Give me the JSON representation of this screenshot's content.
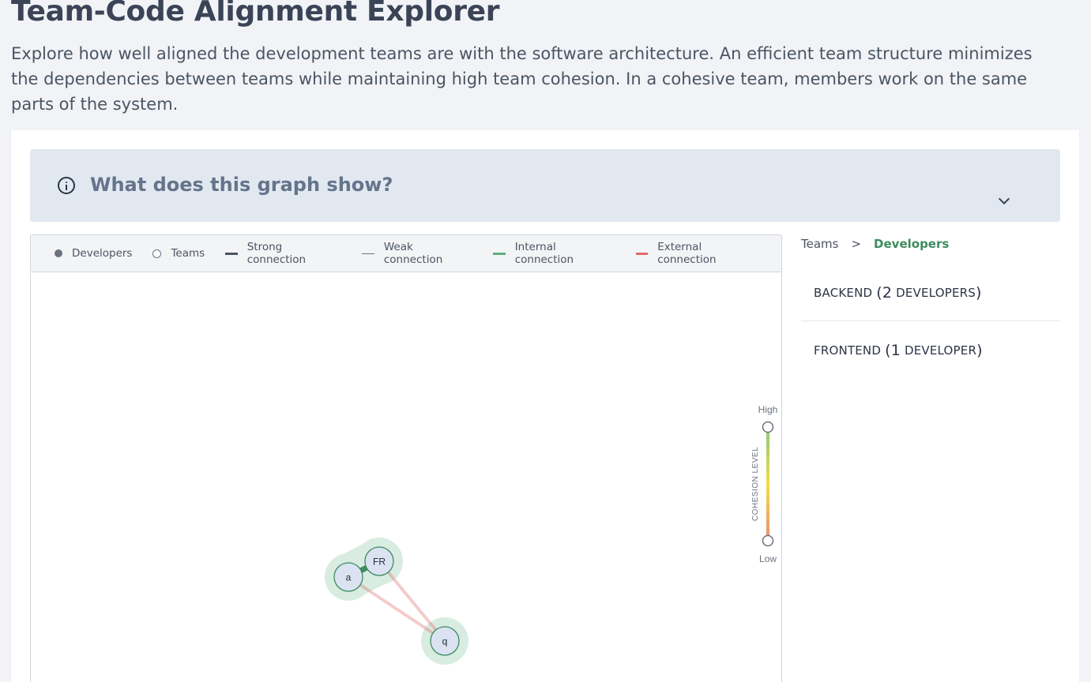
{
  "page": {
    "title": "Team-Code Alignment Explorer",
    "description": "Explore how well aligned the development teams are with the software architecture. An efficient team structure minimizes the dependencies between teams while maintaining high team cohesion. In a cohesive team, members work on the same parts of the system."
  },
  "info_panel": {
    "title": "What does this graph show?",
    "icon": "info-icon",
    "toggle_icon": "chevron-down-icon"
  },
  "legend": [
    {
      "key": "developers",
      "label": "Developers"
    },
    {
      "key": "teams",
      "label": "Teams"
    },
    {
      "key": "strong",
      "label": "Strong connection"
    },
    {
      "key": "weak",
      "label": "Weak connection"
    },
    {
      "key": "internal",
      "label": "Internal connection"
    },
    {
      "key": "external",
      "label": "External connection"
    }
  ],
  "colors": {
    "internal": "#5fae82",
    "external": "#e06b6b",
    "team_halo": "#d9ece2",
    "node_fill": "#dbe3f3",
    "node_stroke": "#3d8b5e",
    "breadcrumb_active": "#3d8b5e"
  },
  "cohesion_scale": {
    "label": "COHESION LEVEL",
    "high": "High",
    "low": "Low"
  },
  "graph": {
    "nodes": [
      {
        "id": "a",
        "label": "a"
      },
      {
        "id": "FR",
        "label": "FR"
      },
      {
        "id": "q",
        "label": "q"
      }
    ],
    "edges": [
      {
        "from": "a",
        "to": "FR",
        "type": "internal",
        "strength": "strong"
      },
      {
        "from": "a",
        "to": "q",
        "type": "external",
        "strength": "weak"
      },
      {
        "from": "FR",
        "to": "q",
        "type": "external",
        "strength": "weak"
      }
    ]
  },
  "breadcrumb": {
    "root": "Teams",
    "separator": ">",
    "current": "Developers"
  },
  "teams": [
    {
      "name": "Backend",
      "open": "(",
      "count": "2",
      "unit": "Developers",
      "close": ")"
    },
    {
      "name": "Frontend",
      "open": "(",
      "count": "1",
      "unit": "Developer",
      "close": ")"
    }
  ]
}
